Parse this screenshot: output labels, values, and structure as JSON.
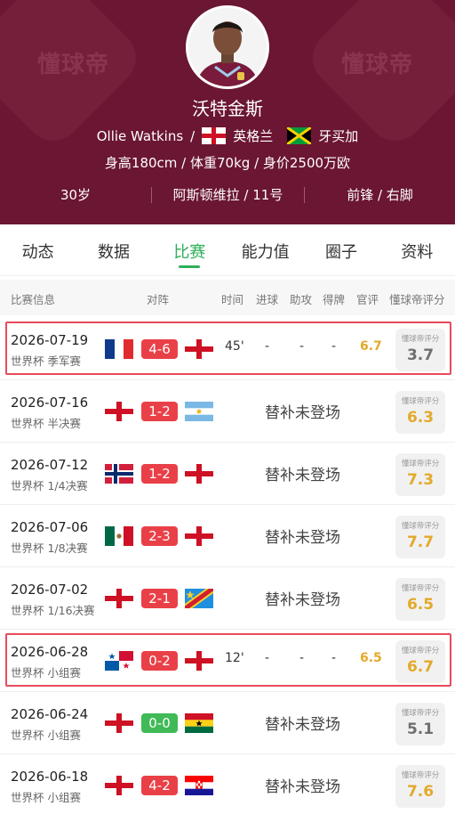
{
  "header": {
    "watermark": "懂球帝",
    "name_cn": "沃特金斯",
    "name_en": "Ollie Watkins",
    "separator": "/",
    "nation1": "英格兰",
    "nation2": "牙买加",
    "body_info": "身高180cm / 体重70kg / 身价2500万欧",
    "age": "30岁",
    "club": "阿斯顿维拉 / 11号",
    "position": "前锋 / 右脚"
  },
  "tabs": [
    {
      "label": "动态",
      "active": false
    },
    {
      "label": "数据",
      "active": false
    },
    {
      "label": "比赛",
      "active": true
    },
    {
      "label": "能力值",
      "active": false
    },
    {
      "label": "圈子",
      "active": false
    },
    {
      "label": "资料",
      "active": false
    }
  ],
  "table_header": {
    "info": "比赛信息",
    "matchup": "对阵",
    "time": "时间",
    "goals": "进球",
    "assists": "助攻",
    "cards": "得牌",
    "official": "官评",
    "dqd": "懂球帝评分"
  },
  "rating_label": "懂球帝评分",
  "matches": [
    {
      "date": "2026-07-19",
      "comp": "世界杯 季军赛",
      "home": "france",
      "away": "england",
      "score": "4-6",
      "result": "loss",
      "played": true,
      "minutes": "45'",
      "goals": "-",
      "assists": "-",
      "cards": "-",
      "official": "6.7",
      "rating": "3.7",
      "rating_color": "grey",
      "highlight": true
    },
    {
      "date": "2026-07-16",
      "comp": "世界杯 半决赛",
      "home": "england",
      "away": "argentina",
      "score": "1-2",
      "result": "loss",
      "played": false,
      "note": "替补未登场",
      "rating": "6.3",
      "rating_color": "gold",
      "highlight": false
    },
    {
      "date": "2026-07-12",
      "comp": "世界杯 1/4决赛",
      "home": "norway",
      "away": "england",
      "score": "1-2",
      "result": "loss",
      "played": false,
      "note": "替补未登场",
      "rating": "7.3",
      "rating_color": "gold",
      "highlight": false
    },
    {
      "date": "2026-07-06",
      "comp": "世界杯 1/8决赛",
      "home": "mexico",
      "away": "england",
      "score": "2-3",
      "result": "loss",
      "played": false,
      "note": "替补未登场",
      "rating": "7.7",
      "rating_color": "gold",
      "highlight": false
    },
    {
      "date": "2026-07-02",
      "comp": "世界杯 1/16决赛",
      "home": "england",
      "away": "dr-congo",
      "score": "2-1",
      "result": "loss",
      "played": false,
      "note": "替补未登场",
      "rating": "6.5",
      "rating_color": "gold",
      "highlight": false
    },
    {
      "date": "2026-06-28",
      "comp": "世界杯 小组赛",
      "home": "panama",
      "away": "england",
      "score": "0-2",
      "result": "loss",
      "played": true,
      "minutes": "12'",
      "goals": "-",
      "assists": "-",
      "cards": "-",
      "official": "6.5",
      "rating": "6.7",
      "rating_color": "gold",
      "highlight": true
    },
    {
      "date": "2026-06-24",
      "comp": "世界杯 小组赛",
      "home": "england",
      "away": "ghana",
      "score": "0-0",
      "result": "draw",
      "played": false,
      "note": "替补未登场",
      "rating": "5.1",
      "rating_color": "grey",
      "highlight": false
    },
    {
      "date": "2026-06-18",
      "comp": "世界杯 小组赛",
      "home": "england",
      "away": "croatia",
      "score": "4-2",
      "result": "loss",
      "played": false,
      "note": "替补未登场",
      "rating": "7.6",
      "rating_color": "gold",
      "highlight": false
    }
  ],
  "colors": {
    "header_bg": "#6b1632",
    "accent_green": "#2fae5a",
    "score_red": "#e94048",
    "score_green": "#3fba57",
    "rating_gold": "#e3a92a",
    "highlight_red": "#e84b5a"
  }
}
